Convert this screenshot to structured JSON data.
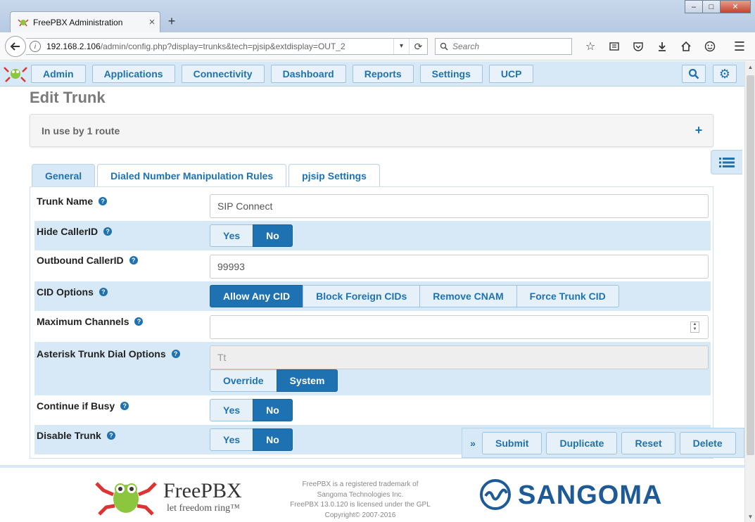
{
  "browser": {
    "tab_title": "FreePBX Administration",
    "tab_close": "×",
    "new_tab": "+",
    "url_host": "192.168.2.106",
    "url_path": "/admin/config.php?display=trunks&tech=pjsip&extdisplay=OUT_2",
    "search_placeholder": "Search",
    "win_minimize": "–",
    "win_maximize": "□",
    "win_close": "✕"
  },
  "top_nav": {
    "items": [
      "Admin",
      "Applications",
      "Connectivity",
      "Dashboard",
      "Reports",
      "Settings",
      "UCP"
    ]
  },
  "page": {
    "title": "Edit Trunk",
    "usage": "In use by 1 route",
    "usage_expand": "+"
  },
  "tabs": [
    "General",
    "Dialed Number Manipulation Rules",
    "pjsip Settings"
  ],
  "form": {
    "trunk_name": {
      "label": "Trunk Name",
      "value": "SIP Connect"
    },
    "hide_callerid": {
      "label": "Hide CallerID",
      "options": [
        "Yes",
        "No"
      ],
      "selected": "No"
    },
    "outbound_callerid": {
      "label": "Outbound CallerID",
      "value": "99993"
    },
    "cid_options": {
      "label": "CID Options",
      "options": [
        "Allow Any CID",
        "Block Foreign CIDs",
        "Remove CNAM",
        "Force Trunk CID"
      ],
      "selected": "Allow Any CID"
    },
    "max_channels": {
      "label": "Maximum Channels",
      "value": ""
    },
    "dial_options": {
      "label": "Asterisk Trunk Dial Options",
      "placeholder": "Tt",
      "options": [
        "Override",
        "System"
      ],
      "selected": "System"
    },
    "continue_if_busy": {
      "label": "Continue if Busy",
      "options": [
        "Yes",
        "No"
      ],
      "selected": "No"
    },
    "disable_trunk": {
      "label": "Disable Trunk",
      "options": [
        "Yes",
        "No"
      ],
      "selected": "No"
    }
  },
  "actions": {
    "chevron": "»",
    "submit": "Submit",
    "duplicate": "Duplicate",
    "reset": "Reset",
    "delete": "Delete"
  },
  "footer": {
    "brand": "FreePBX",
    "tagline": "let freedom ring™",
    "legal_1": "FreePBX is a registered trademark of",
    "legal_2": "Sangoma Technologies Inc.",
    "legal_3": "FreePBX 13.0.120 is licensed under the GPL",
    "legal_4": "Copyright© 2007-2016",
    "sangoma": "SANGOMA"
  },
  "colors": {
    "accent": "#1f72b1",
    "nav_bg": "#d7e8f6"
  }
}
